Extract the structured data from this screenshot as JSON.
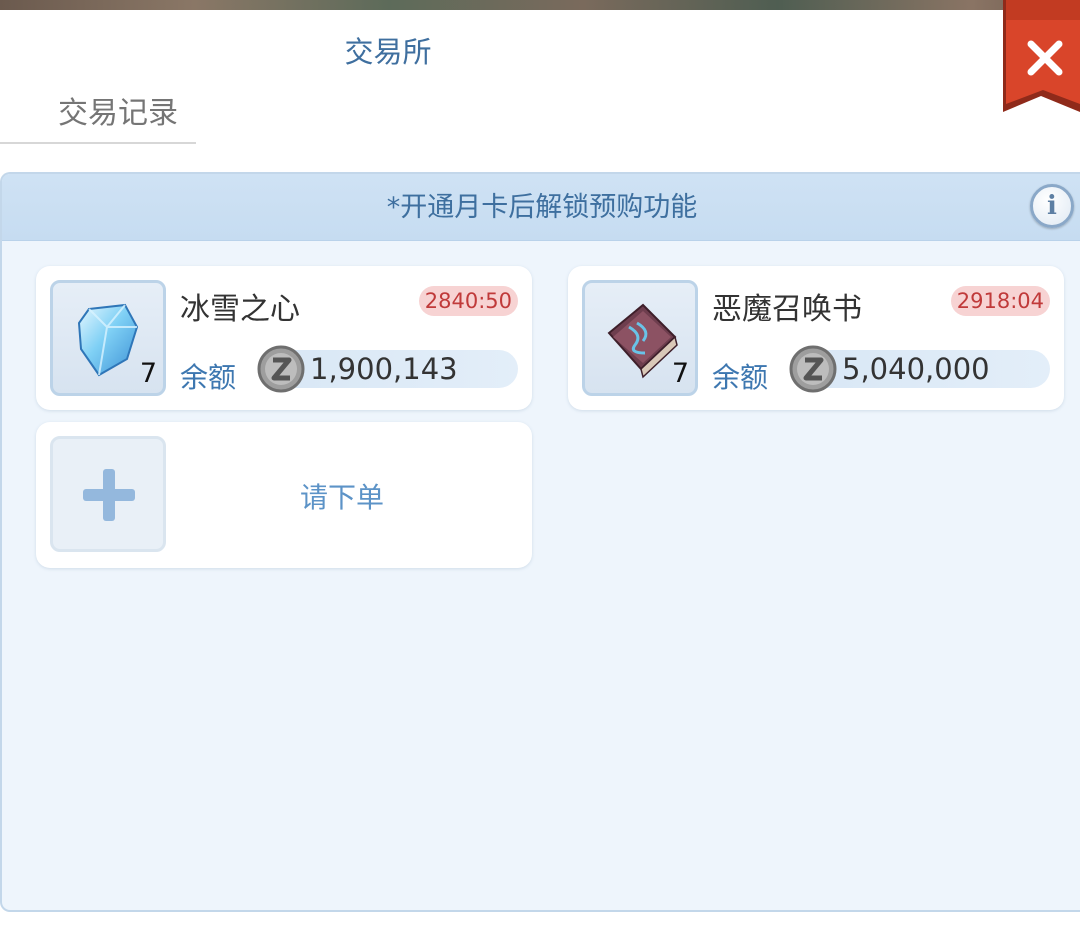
{
  "header": {
    "title": "交易所"
  },
  "tabs": [
    {
      "label": "交易记录"
    }
  ],
  "notice": {
    "text": "*开通月卡后解锁预购功能"
  },
  "orders": [
    {
      "name": "冰雪之心",
      "quantity": "7",
      "timer": "2840:50",
      "balance_label": "余额",
      "balance": "1,900,143",
      "icon": "ice-crystal-icon"
    },
    {
      "name": "恶魔召唤书",
      "quantity": "7",
      "timer": "2918:04",
      "balance_label": "余额",
      "balance": "5,040,000",
      "icon": "demon-book-icon"
    }
  ],
  "new_order": {
    "label": "请下单"
  },
  "colors": {
    "accent": "#3d77b0",
    "timer_bg": "#f7d3d3",
    "timer_text": "#c03a3a",
    "close_bg": "#d9452a"
  }
}
